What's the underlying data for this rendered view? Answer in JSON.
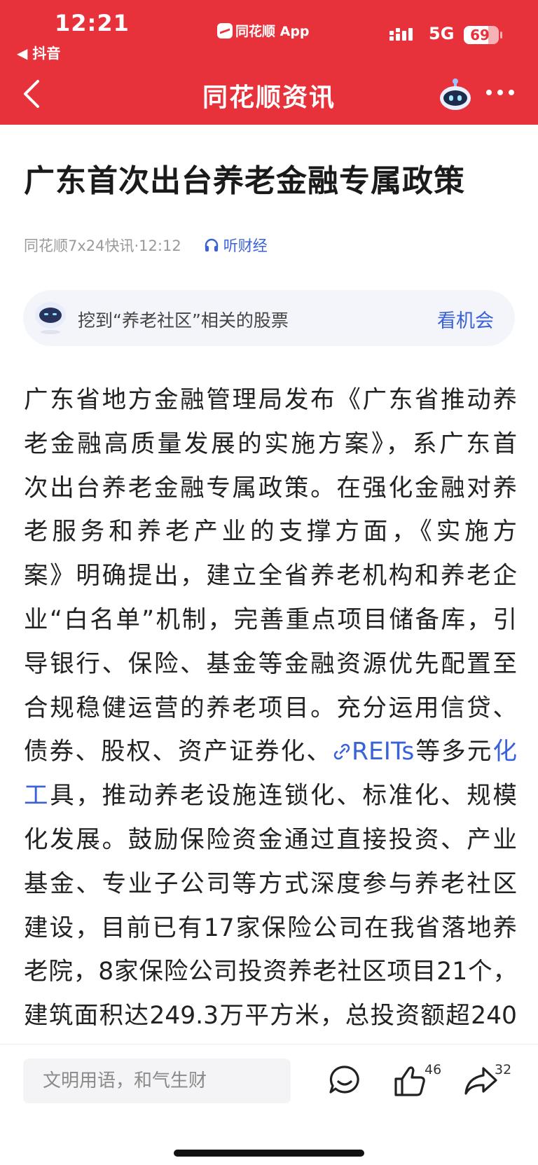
{
  "status_bar": {
    "time": "12:21",
    "back_app": "◀ 抖音",
    "center_app": "同花顺 App",
    "network": "5G",
    "battery": "69",
    "battery_level": 0.69
  },
  "nav": {
    "title": "同花顺资讯"
  },
  "article": {
    "title": "广东首次出台养老金融专属政策",
    "source": "同花顺7x24快讯·12:12",
    "listen_label": "听财经",
    "stock_card": {
      "text": "挖到“养老社区”相关的股票",
      "link": "看机会"
    },
    "body_lines": [
      [
        "广东省地方金融管理局发布《广东省推动养"
      ],
      [
        "老金融高质量发展的实施方案》，系广东首"
      ],
      [
        "次出台养老金融专属政策。在强化金融对养"
      ],
      [
        "老服务和养老产业的支撑方面，《实施方"
      ],
      [
        "案》明确提出，建立全省养老机构和养老企"
      ],
      [
        "业“白名单”机制，完善重点项目储备库，引"
      ],
      [
        "导银行、保险、基金等金融资源优先配置至"
      ],
      [
        "合规稳健运营的养老项目。充分运用信贷、"
      ],
      [
        "债券、股权、资产证券化、",
        "REITs",
        "等多元",
        "化"
      ],
      [
        "工",
        "具，推动养老设施连锁化、标准化、规模"
      ],
      [
        "化发展。鼓励保险资金通过直接投资、产业"
      ],
      [
        "基金、专业子公司等方式深度参与养老社区"
      ],
      [
        "建设，目前已有17家保险公司在我省落地养"
      ],
      [
        "老院，8家保险公司投资养老社区项目21个，"
      ],
      [
        "建筑面积达249.3万平方米，总投资额超240"
      ]
    ]
  },
  "bottom_bar": {
    "comment_placeholder": "文明用语，和气生财",
    "like_count": "46",
    "share_count": "32"
  },
  "colors": {
    "brand_red": "#e8323b",
    "link_blue": "#3a62d8"
  },
  "icons": [
    "back-arrow-icon",
    "robot-assistant-icon",
    "more-dots-icon",
    "headphones-icon",
    "link-icon",
    "comment-icon",
    "like-icon",
    "share-icon"
  ]
}
